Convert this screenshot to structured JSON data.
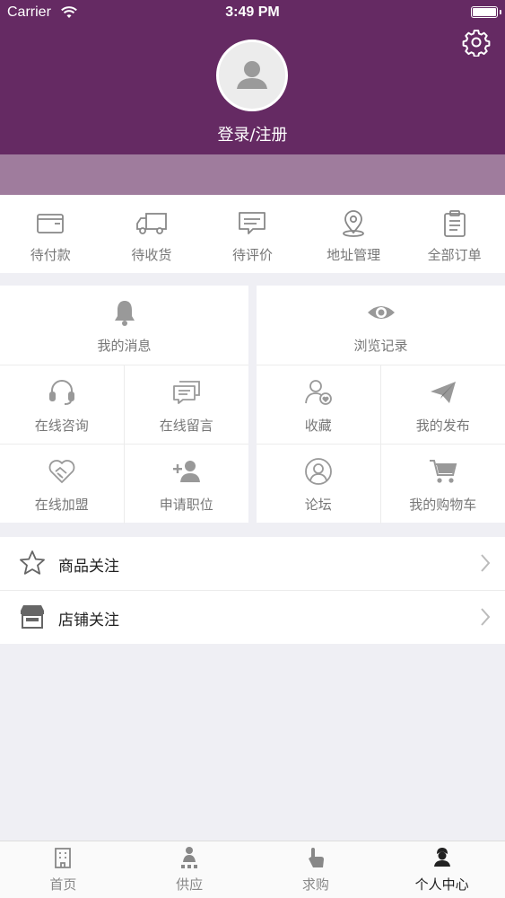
{
  "status_bar": {
    "carrier": "Carrier",
    "time": "3:49 PM"
  },
  "header": {
    "login_label": "登录/注册",
    "accent": "#652a63",
    "band_color": "#9f7c9d"
  },
  "orders": [
    {
      "label": "待付款",
      "icon": "wallet-icon"
    },
    {
      "label": "待收货",
      "icon": "truck-icon"
    },
    {
      "label": "待评价",
      "icon": "comment-icon"
    },
    {
      "label": "地址管理",
      "icon": "location-pin-icon"
    },
    {
      "label": "全部订单",
      "icon": "clipboard-icon"
    }
  ],
  "grid_left": [
    {
      "label": "我的消息",
      "icon": "bell-icon"
    },
    {
      "label": "在线咨询",
      "icon": "headset-icon"
    },
    {
      "label": "在线留言",
      "icon": "messages-icon"
    },
    {
      "label": "在线加盟",
      "icon": "handshake-heart-icon"
    },
    {
      "label": "申请职位",
      "icon": "add-user-icon"
    }
  ],
  "grid_right": [
    {
      "label": "浏览记录",
      "icon": "eye-icon"
    },
    {
      "label": "收藏",
      "icon": "user-heart-icon"
    },
    {
      "label": "我的发布",
      "icon": "paper-plane-icon"
    },
    {
      "label": "论坛",
      "icon": "forum-user-icon"
    },
    {
      "label": "我的购物车",
      "icon": "cart-icon"
    }
  ],
  "follow_list": [
    {
      "label": "商品关注",
      "icon": "star-icon"
    },
    {
      "label": "店铺关注",
      "icon": "store-icon"
    }
  ],
  "tabbar": [
    {
      "label": "首页",
      "icon": "building-icon"
    },
    {
      "label": "供应",
      "icon": "supply-icon"
    },
    {
      "label": "求购",
      "icon": "hand-pointer-icon"
    },
    {
      "label": "个人中心",
      "icon": "person-center-icon",
      "active": true
    }
  ]
}
